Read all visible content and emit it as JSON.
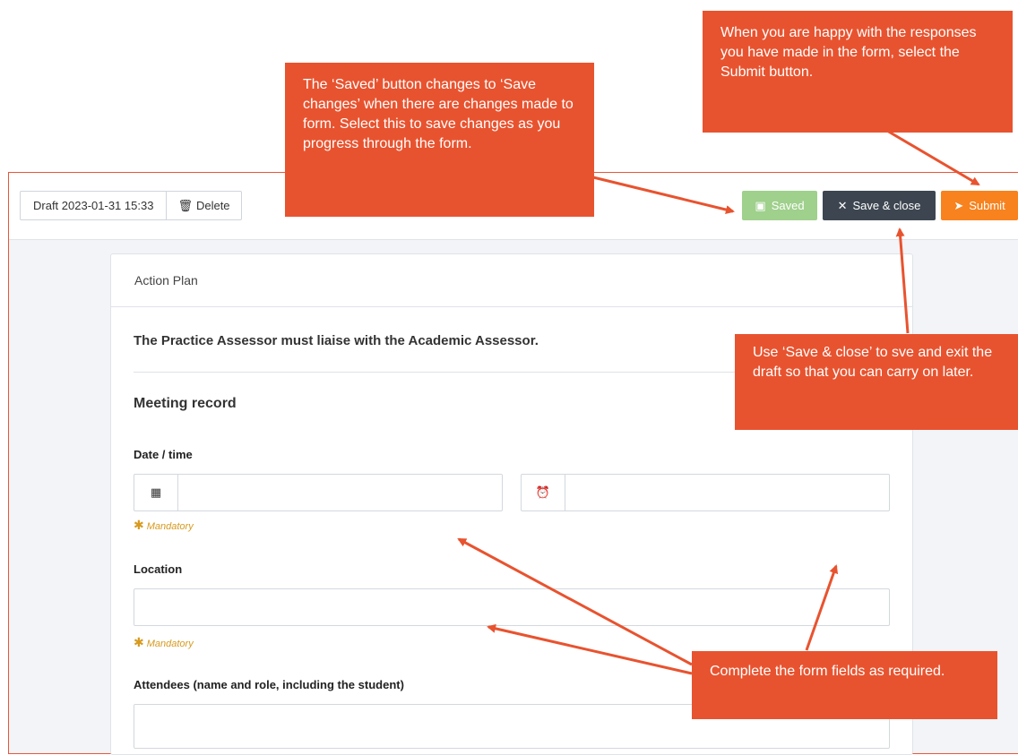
{
  "toolbar": {
    "draft_label": "Draft 2023-01-31 15:33",
    "delete_label": "Delete",
    "saved_label": "Saved",
    "save_close_label": "Save & close",
    "submit_label": "Submit"
  },
  "form": {
    "card_title": "Action Plan",
    "instruction": "The Practice Assessor must liaise with the Academic Assessor.",
    "section_title": "Meeting record",
    "date_time_label": "Date / time",
    "date_value": "",
    "time_value": "",
    "mandatory_text": "Mandatory",
    "location_label": "Location",
    "location_value": "",
    "attendees_label": "Attendees (name and role, including the student)",
    "attendees_value": ""
  },
  "callouts": {
    "saved": "The ‘Saved’ button changes to ‘Save changes’ when there are changes made to form. Select this to save changes as you progress through the form.",
    "submit": "When you are happy with the responses you have made in the form, select the Submit button.",
    "save_close": "Use ‘Save & close’ to sve and exit the draft so that you can carry on later.",
    "fields": "Complete the form fields as required."
  },
  "colors": {
    "callout": "#e8532f",
    "saved_button": "#9fd08c",
    "save_close_button": "#3d4650",
    "submit_button": "#f7821e",
    "mandatory": "#d79a1e"
  },
  "icons": {
    "delete": "trash-icon",
    "saved": "floppy-icon",
    "save_close": "close-icon",
    "submit": "paper-plane-icon",
    "date": "calendar-icon",
    "time": "clock-icon"
  }
}
